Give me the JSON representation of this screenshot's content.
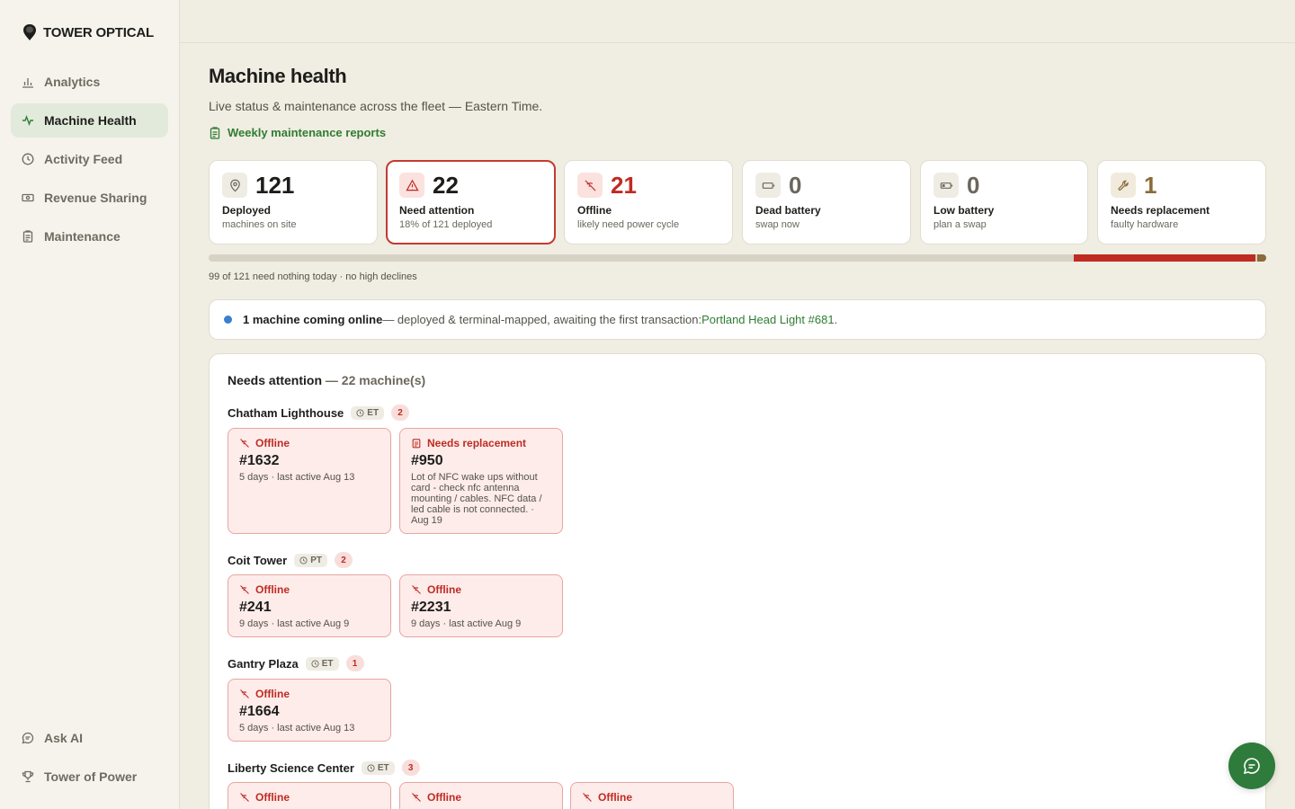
{
  "brand": {
    "name": "TOWER OPTICAL"
  },
  "sidebar": {
    "items": [
      {
        "label": "Analytics",
        "icon": "bar-chart-icon"
      },
      {
        "label": "Machine Health",
        "icon": "pulse-icon",
        "active": true
      },
      {
        "label": "Activity Feed",
        "icon": "clock-icon"
      },
      {
        "label": "Revenue Sharing",
        "icon": "cash-icon"
      },
      {
        "label": "Maintenance",
        "icon": "clipboard-icon"
      }
    ],
    "bottom_items": [
      {
        "label": "Ask AI",
        "icon": "chat-icon"
      },
      {
        "label": "Tower of Power",
        "icon": "trophy-icon"
      }
    ]
  },
  "header": {
    "title": "Machine health",
    "subtitle": "Live status & maintenance across the fleet — Eastern Time.",
    "reports_link": "Weekly maintenance reports"
  },
  "stats": [
    {
      "value": "121",
      "label": "Deployed",
      "sub": "machines on site",
      "icon": "location-pin-icon",
      "color": "#1d1d1b"
    },
    {
      "value": "22",
      "label": "Need attention",
      "sub": "18% of 121 deployed",
      "icon": "warning-icon",
      "color": "#1d1d1b",
      "selected": true
    },
    {
      "value": "21",
      "label": "Offline",
      "sub": "likely need power cycle",
      "icon": "offline-icon",
      "color": "#bf2b23"
    },
    {
      "value": "0",
      "label": "Dead battery",
      "sub": "swap now",
      "icon": "battery-empty-icon",
      "color": "#6b675d"
    },
    {
      "value": "0",
      "label": "Low battery",
      "sub": "plan a swap",
      "icon": "battery-low-icon",
      "color": "#6b675d"
    },
    {
      "value": "1",
      "label": "Needs replacement",
      "sub": "faulty hardware",
      "icon": "wrench-icon",
      "color": "#8b6b3a"
    }
  ],
  "health_bar": {
    "total": 121,
    "ok": 99,
    "offline": 21,
    "replacement": 1,
    "colors": {
      "ok": "#d6d2c5",
      "offline": "#bf2b23",
      "replacement": "#8b6b3a"
    }
  },
  "health_note": "99 of 121 need nothing today · no high declines",
  "banner": {
    "bold": "1 machine coming online",
    "text": " — deployed & terminal-mapped, awaiting the first transaction: ",
    "link": "Portland Head Light #681",
    "end": "."
  },
  "attention": {
    "title": "Needs attention",
    "count": " — 22 machine(s)",
    "locations": [
      {
        "name": "Chatham Lighthouse",
        "tz": "ET",
        "count": "2",
        "machines": [
          {
            "status": "Offline",
            "icon": "offline-icon",
            "id": "#1632",
            "detail": "5 days · last active Aug 13"
          },
          {
            "status": "Needs replacement",
            "icon": "clipboard-icon",
            "id": "#950",
            "detail": "Lot of NFC wake ups without card - check nfc antenna mounting / cables. NFC data / led cable is not connected. · Aug 19"
          }
        ]
      },
      {
        "name": "Coit Tower",
        "tz": "PT",
        "count": "2",
        "machines": [
          {
            "status": "Offline",
            "icon": "offline-icon",
            "id": "#241",
            "detail": "9 days · last active Aug 9"
          },
          {
            "status": "Offline",
            "icon": "offline-icon",
            "id": "#2231",
            "detail": "9 days · last active Aug 9"
          }
        ]
      },
      {
        "name": "Gantry Plaza",
        "tz": "ET",
        "count": "1",
        "machines": [
          {
            "status": "Offline",
            "icon": "offline-icon",
            "id": "#1664",
            "detail": "5 days · last active Aug 13"
          }
        ]
      },
      {
        "name": "Liberty Science Center",
        "tz": "ET",
        "count": "3",
        "machines": [
          {
            "status": "Offline",
            "icon": "offline-icon"
          },
          {
            "status": "Offline",
            "icon": "offline-icon"
          },
          {
            "status": "Offline",
            "icon": "offline-icon"
          }
        ]
      }
    ]
  },
  "chat": {
    "icon": "chat-bubble-icon"
  }
}
